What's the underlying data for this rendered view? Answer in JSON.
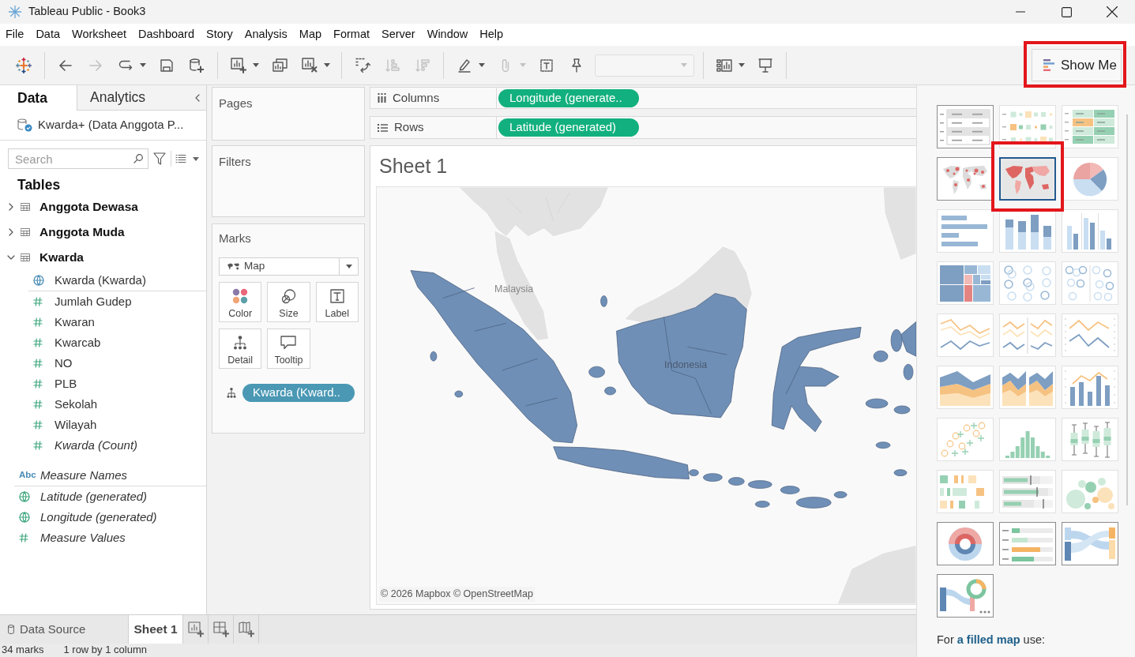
{
  "window": {
    "title": "Tableau Public - Book3"
  },
  "menu": [
    "File",
    "Data",
    "Worksheet",
    "Dashboard",
    "Story",
    "Analysis",
    "Map",
    "Format",
    "Server",
    "Window",
    "Help"
  ],
  "toolbar": {
    "groups": [
      {
        "buttons": [
          {
            "kind": "back",
            "disabled": false,
            "menu": false
          },
          {
            "kind": "forward",
            "disabled": true,
            "menu": false
          },
          {
            "kind": "redo",
            "disabled": false,
            "menu": true
          },
          {
            "kind": "save",
            "disabled": false,
            "menu": false
          },
          {
            "kind": "new_data_source",
            "disabled": false,
            "menu": false
          }
        ]
      },
      {
        "buttons": [
          {
            "kind": "new_sheet",
            "disabled": false,
            "menu": true
          },
          {
            "kind": "duplicate",
            "disabled": false,
            "menu": false
          },
          {
            "kind": "clear",
            "disabled": false,
            "menu": true
          }
        ]
      },
      {
        "buttons": [
          {
            "kind": "swap",
            "disabled": false,
            "menu": false
          },
          {
            "kind": "sort_asc",
            "disabled": true,
            "menu": false
          },
          {
            "kind": "sort_desc",
            "disabled": true,
            "menu": false
          }
        ]
      },
      {
        "buttons": [
          {
            "kind": "highlight",
            "disabled": false,
            "menu": true
          },
          {
            "kind": "group",
            "disabled": true,
            "menu": true
          },
          {
            "kind": "labels",
            "disabled": false,
            "menu": false
          },
          {
            "kind": "pin",
            "disabled": false,
            "menu": false
          },
          {
            "kind": "combo",
            "disabled": true,
            "menu": false
          }
        ]
      },
      {
        "buttons": [
          {
            "kind": "fit",
            "disabled": false,
            "menu": true
          },
          {
            "kind": "present",
            "disabled": false,
            "menu": false
          }
        ]
      }
    ],
    "show_me": {
      "label": "Show Me",
      "highlighted": true
    }
  },
  "data_pane": {
    "tabs": [
      {
        "label": "Data",
        "selected": true
      },
      {
        "label": "Analytics",
        "selected": false
      }
    ],
    "source": "Kwarda+ (Data Anggota P...",
    "search": {
      "placeholder": "Search"
    },
    "heading": "Tables",
    "tables": [
      {
        "name": "Anggota Dewasa",
        "expanded": false
      },
      {
        "name": "Anggota Muda",
        "expanded": false
      },
      {
        "name": "Kwarda",
        "expanded": true,
        "children": [
          {
            "name": "Kwarda (Kwarda)",
            "kind": "geo",
            "measure": false,
            "generated": false
          },
          {
            "name": "Jumlah Gudep",
            "kind": "number",
            "measure": true,
            "generated": false
          },
          {
            "name": "Kwaran",
            "kind": "number",
            "measure": true,
            "generated": false
          },
          {
            "name": "Kwarcab",
            "kind": "number",
            "measure": true,
            "generated": false
          },
          {
            "name": "NO",
            "kind": "number",
            "measure": true,
            "generated": false
          },
          {
            "name": "PLB",
            "kind": "number",
            "measure": true,
            "generated": false
          },
          {
            "name": "Sekolah",
            "kind": "number",
            "measure": true,
            "generated": false
          },
          {
            "name": "Wilayah",
            "kind": "number",
            "measure": true,
            "generated": false
          },
          {
            "name": "Kwarda (Count)",
            "kind": "number",
            "measure": true,
            "generated": true
          }
        ]
      }
    ],
    "fields": [
      {
        "name": "Measure Names",
        "kind": "text",
        "icon_text": "Abc",
        "measure": false,
        "generated": true
      },
      {
        "name": "Latitude (generated)",
        "kind": "geo",
        "measure": true,
        "generated": true
      },
      {
        "name": "Longitude (generated)",
        "kind": "geo",
        "measure": true,
        "generated": true
      },
      {
        "name": "Measure Values",
        "kind": "number",
        "measure": true,
        "generated": true
      }
    ]
  },
  "cards": {
    "pages": {
      "title": "Pages"
    },
    "filters": {
      "title": "Filters"
    },
    "marks": {
      "title": "Marks",
      "mark_type": "Map",
      "properties": [
        {
          "kind": "color",
          "label": "Color"
        },
        {
          "kind": "size",
          "label": "Size"
        },
        {
          "kind": "label",
          "label": "Label"
        },
        {
          "kind": "detail",
          "label": "Detail"
        },
        {
          "kind": "tooltip",
          "label": "Tooltip"
        }
      ],
      "pills": [
        {
          "label": "Kwarda (Kward..",
          "color": "#4a98b4",
          "kind": "detail"
        }
      ]
    }
  },
  "shelves": [
    {
      "kind": "columns",
      "label": "Columns",
      "pills": [
        {
          "label": "Longitude (generate..",
          "color": "#12b07e"
        }
      ]
    },
    {
      "kind": "rows",
      "label": "Rows",
      "pills": [
        {
          "label": "Latitude (generated)",
          "color": "#12b07e"
        }
      ]
    }
  ],
  "sheet": {
    "title": "Sheet 1",
    "map": {
      "labels": [
        "Malaysia",
        "Indonesia"
      ],
      "attribution": "© 2026 Mapbox © OpenStreetMap"
    }
  },
  "show_me_panel": {
    "charts": [
      {
        "kind": "text_table",
        "available": true,
        "selected": false,
        "highlighted": false
      },
      {
        "kind": "heat_map",
        "available": false,
        "selected": false,
        "highlighted": false
      },
      {
        "kind": "highlight_table",
        "available": false,
        "selected": false,
        "highlighted": false
      },
      {
        "kind": "symbol_map",
        "available": true,
        "selected": false,
        "highlighted": false
      },
      {
        "kind": "filled_map",
        "available": true,
        "selected": true,
        "highlighted": true
      },
      {
        "kind": "pie",
        "available": false,
        "selected": false,
        "highlighted": false
      },
      {
        "kind": "hbar",
        "available": false,
        "selected": false,
        "highlighted": false
      },
      {
        "kind": "stacked_bar",
        "available": false,
        "selected": false,
        "highlighted": false
      },
      {
        "kind": "side_bar",
        "available": false,
        "selected": false,
        "highlighted": false
      },
      {
        "kind": "treemap",
        "available": false,
        "selected": false,
        "highlighted": false
      },
      {
        "kind": "circle",
        "available": false,
        "selected": false,
        "highlighted": false
      },
      {
        "kind": "side_circle",
        "available": false,
        "selected": false,
        "highlighted": false
      },
      {
        "kind": "line_cont",
        "available": false,
        "selected": false,
        "highlighted": false
      },
      {
        "kind": "line_disc",
        "available": false,
        "selected": false,
        "highlighted": false
      },
      {
        "kind": "dual_line",
        "available": false,
        "selected": false,
        "highlighted": false
      },
      {
        "kind": "area_cont",
        "available": false,
        "selected": false,
        "highlighted": false
      },
      {
        "kind": "area_disc",
        "available": false,
        "selected": false,
        "highlighted": false
      },
      {
        "kind": "dual_combo",
        "available": false,
        "selected": false,
        "highlighted": false
      },
      {
        "kind": "scatter",
        "available": false,
        "selected": false,
        "highlighted": false
      },
      {
        "kind": "histogram",
        "available": false,
        "selected": false,
        "highlighted": false
      },
      {
        "kind": "box_plot",
        "available": false,
        "selected": false,
        "highlighted": false
      },
      {
        "kind": "gantt",
        "available": false,
        "selected": false,
        "highlighted": false
      },
      {
        "kind": "bullet",
        "available": false,
        "selected": false,
        "highlighted": false
      },
      {
        "kind": "bubbles",
        "available": false,
        "selected": false,
        "highlighted": false
      },
      {
        "kind": "donut",
        "available": true,
        "selected": false,
        "highlighted": false
      },
      {
        "kind": "bar_text",
        "available": true,
        "selected": false,
        "highlighted": false
      },
      {
        "kind": "sankey",
        "available": true,
        "selected": false,
        "highlighted": false
      },
      {
        "kind": "sankey_donut",
        "available": true,
        "selected": false,
        "highlighted": false
      }
    ],
    "hint": "For **a filled map** use:"
  },
  "sheet_tabs": [
    {
      "kind": "data_source",
      "label": "Data Source",
      "selected": false
    },
    {
      "kind": "worksheet",
      "label": "Sheet 1",
      "selected": true
    }
  ],
  "status_bar": [
    "34 marks",
    "1 row by 1 column"
  ]
}
